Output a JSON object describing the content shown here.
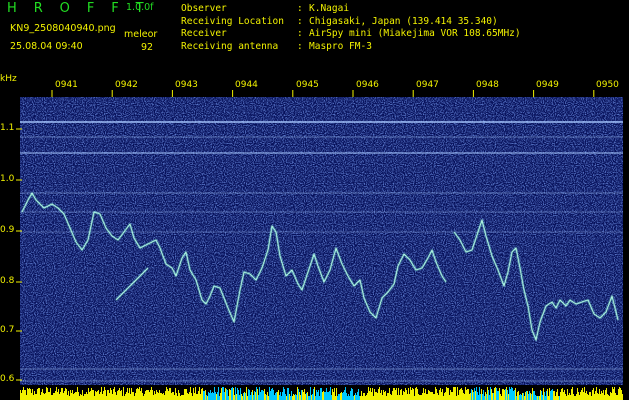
{
  "header": {
    "brand": "H R O F F T",
    "version": "1.0.0f",
    "filename": "KN9_2508040940.png",
    "timestamp": "25.08.04 09:40",
    "colormap_name": "meleor",
    "colormap_value": "92"
  },
  "meta": [
    {
      "key": "Observer",
      "value": "K.Nagai"
    },
    {
      "key": "Receiving Location",
      "value": "Chigasaki, Japan (139.414 35.340)"
    },
    {
      "key": "Receiver",
      "value": "AirSpy mini (Miakejima VOR 108.65MHz)"
    },
    {
      "key": "Receiving antenna",
      "value": "Maspro FM-3"
    }
  ],
  "axis": {
    "unit": "kHz",
    "y_ticks": [
      "1.1",
      "1.0",
      "0.9",
      "0.8",
      "0.7",
      "0.6"
    ],
    "x_ticks": [
      "0941",
      "0942",
      "0943",
      "0944",
      "0945",
      "0946",
      "0947",
      "0948",
      "0949",
      "0950"
    ]
  },
  "colors": {
    "text": "#f2f200",
    "brand": "#22dd22",
    "background": "#000000",
    "noise": "#1b2f92",
    "trace": "#7fffd4",
    "level_bar": "#f2f200",
    "level_bar_alt": "#00c8ff"
  }
}
